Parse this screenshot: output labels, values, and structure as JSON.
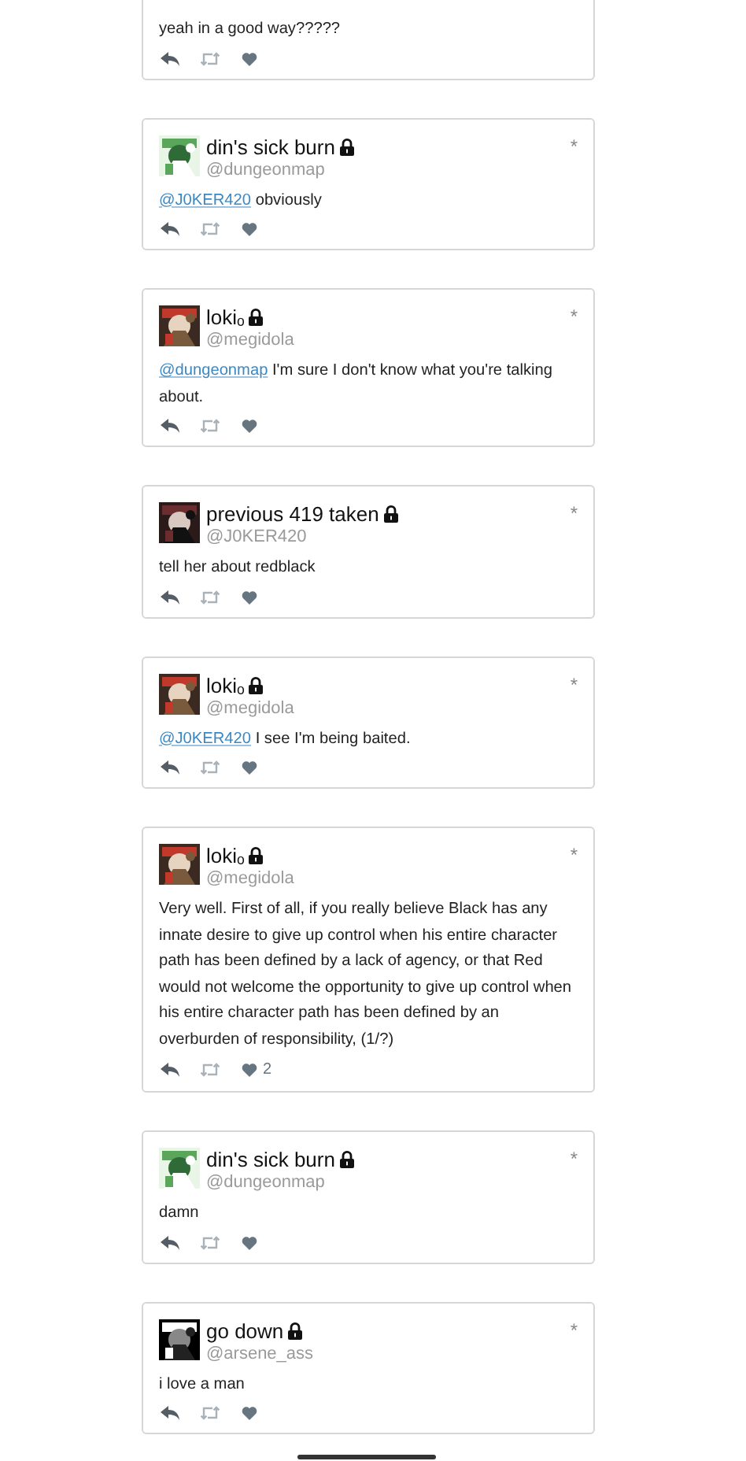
{
  "tweets": [
    {
      "body": {
        "text": "yeah in a good way?????"
      }
    },
    {
      "name": "din's sick burn",
      "handle": "@dungeonmap",
      "locked": true,
      "body": {
        "mention": "@J0KER420",
        "text": "obviously"
      }
    },
    {
      "name": "lokiₒ",
      "handle": "@megidola",
      "locked": true,
      "body": {
        "mention": "@dungeonmap",
        "text": "I'm sure I don't know what you're talking about."
      }
    },
    {
      "name": "previous 419 taken",
      "handle": "@J0KER420",
      "locked": true,
      "body": {
        "text": "tell her about redblack"
      }
    },
    {
      "name": "lokiₒ",
      "handle": "@megidola",
      "locked": true,
      "body": {
        "mention": "@J0KER420",
        "text": "I see I'm being baited."
      }
    },
    {
      "name": "lokiₒ",
      "handle": "@megidola",
      "locked": true,
      "body": {
        "text": "Very well. First of all, if you really believe Black has any innate desire to give up control when his entire character path has been defined by a lack of agency, or that Red would not welcome the opportunity to give up control when his entire character path has been defined by an overburden of responsibility, (1/?)"
      },
      "likes": "2"
    },
    {
      "name": "din's sick burn",
      "handle": "@dungeonmap",
      "locked": true,
      "body": {
        "text": "damn"
      }
    },
    {
      "name": "go down",
      "handle": "@arsene_ass",
      "locked": true,
      "body": {
        "text": "i love a man"
      }
    }
  ],
  "star": "*"
}
